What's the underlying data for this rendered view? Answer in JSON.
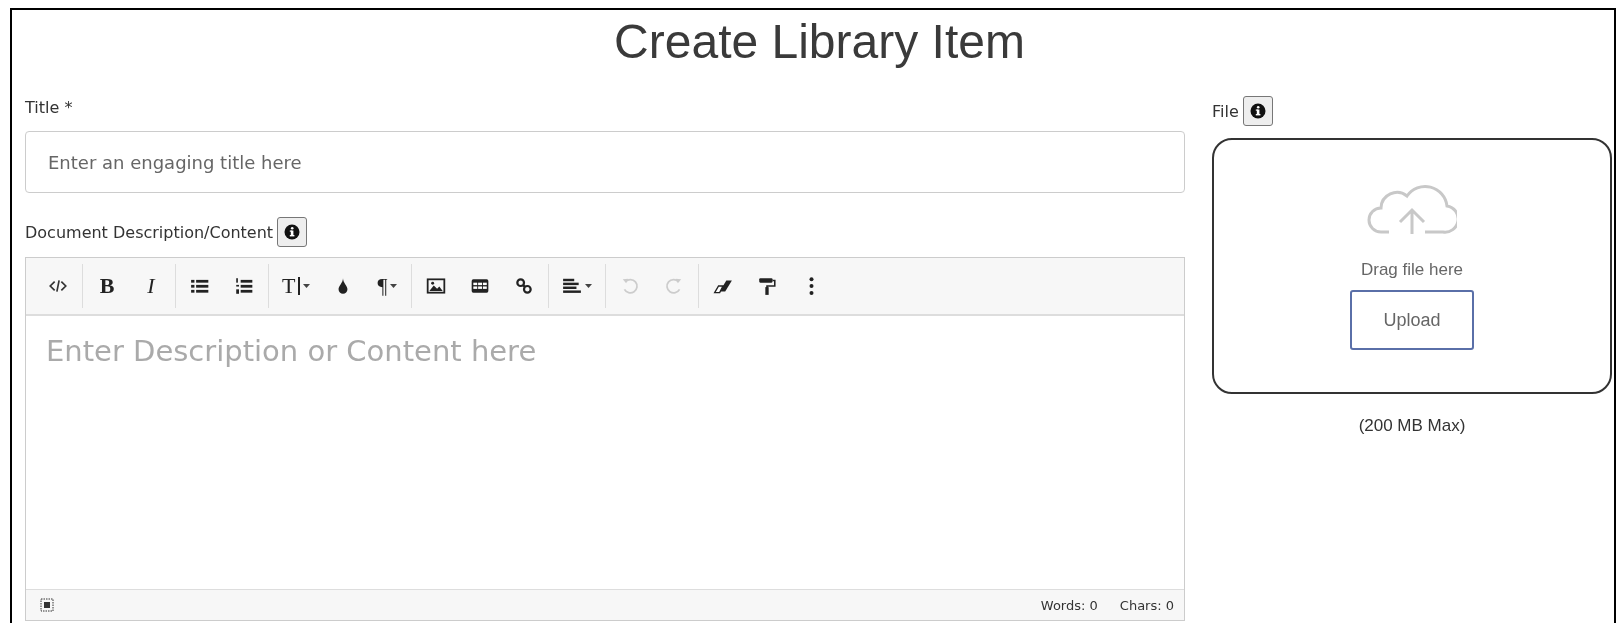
{
  "page_title": "Create Library Item",
  "title_field": {
    "label": "Title *",
    "placeholder": "Enter an engaging title here"
  },
  "description": {
    "label": "Document Description/Content",
    "info": true,
    "placeholder": "Enter Description or Content here",
    "toolbar": [
      [
        {
          "kind": "code",
          "disabled": false,
          "dropdown": false
        }
      ],
      [
        {
          "kind": "bold",
          "label": "B",
          "disabled": false,
          "dropdown": false
        },
        {
          "kind": "italic",
          "label": "I",
          "disabled": false,
          "dropdown": false
        }
      ],
      [
        {
          "kind": "bullets",
          "disabled": false,
          "dropdown": false
        },
        {
          "kind": "numbers",
          "disabled": false,
          "dropdown": false
        }
      ],
      [
        {
          "kind": "fontsize",
          "label": "T",
          "disabled": false,
          "dropdown": true
        },
        {
          "kind": "color",
          "disabled": false,
          "dropdown": false
        },
        {
          "kind": "paragraph",
          "label": "¶",
          "disabled": false,
          "dropdown": true
        }
      ],
      [
        {
          "kind": "image",
          "disabled": false,
          "dropdown": false
        },
        {
          "kind": "table",
          "disabled": false,
          "dropdown": false
        },
        {
          "kind": "link",
          "disabled": false,
          "dropdown": false
        }
      ],
      [
        {
          "kind": "align",
          "disabled": false,
          "dropdown": true
        }
      ],
      [
        {
          "kind": "undo",
          "disabled": true,
          "dropdown": false
        },
        {
          "kind": "redo",
          "disabled": true,
          "dropdown": false
        }
      ],
      [
        {
          "kind": "eraser",
          "disabled": false,
          "dropdown": false
        },
        {
          "kind": "painter",
          "disabled": false,
          "dropdown": false
        },
        {
          "kind": "more",
          "disabled": false,
          "dropdown": false
        }
      ]
    ],
    "status": {
      "words": "Words: 0",
      "chars": "Chars: 0"
    }
  },
  "file": {
    "label": "File",
    "info": true,
    "drop_text": "Drag file here",
    "button": "Upload",
    "limit": "(200 MB Max)"
  }
}
